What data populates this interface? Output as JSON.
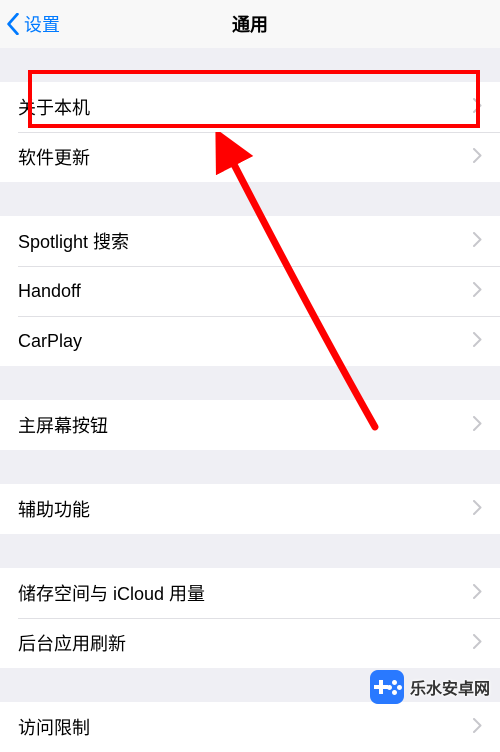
{
  "header": {
    "back_label": "设置",
    "title": "通用"
  },
  "groups": [
    {
      "rows": [
        {
          "key": "about",
          "label": "关于本机"
        },
        {
          "key": "software",
          "label": "软件更新"
        }
      ]
    },
    {
      "rows": [
        {
          "key": "spotlight",
          "label": "Spotlight 搜索"
        },
        {
          "key": "handoff",
          "label": "Handoff"
        },
        {
          "key": "carplay",
          "label": "CarPlay"
        }
      ]
    },
    {
      "rows": [
        {
          "key": "homebtn",
          "label": "主屏幕按钮"
        }
      ]
    },
    {
      "rows": [
        {
          "key": "access",
          "label": "辅助功能"
        }
      ]
    },
    {
      "rows": [
        {
          "key": "storage",
          "label": "储存空间与 iCloud 用量"
        },
        {
          "key": "bgrefresh",
          "label": "后台应用刷新"
        }
      ]
    },
    {
      "rows": [
        {
          "key": "restrict",
          "label": "访问限制"
        }
      ]
    }
  ],
  "watermark": "乐水安卓网",
  "annotation": {
    "highlighted_row": "about",
    "arrow_points_to": "about"
  }
}
